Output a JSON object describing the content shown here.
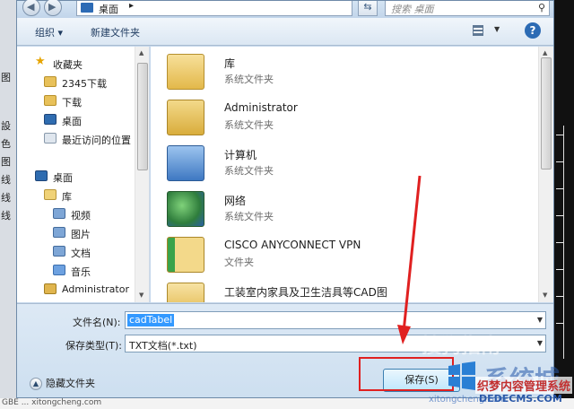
{
  "address_bar": {
    "location": "桌面",
    "search_placeholder": "搜索 桌面"
  },
  "toolbar": {
    "organize": "组织 ▾",
    "new_folder": "新建文件夹"
  },
  "navigation": [
    {
      "label": "收藏夹"
    },
    {
      "label": "2345下载"
    },
    {
      "label": "下载"
    },
    {
      "label": "桌面"
    },
    {
      "label": "最近访问的位置"
    },
    {
      "label": "桌面"
    },
    {
      "label": "库"
    },
    {
      "label": "视频"
    },
    {
      "label": "图片"
    },
    {
      "label": "文档"
    },
    {
      "label": "音乐"
    },
    {
      "label": "Administrator"
    }
  ],
  "files": [
    {
      "name": "库",
      "type": "系统文件夹"
    },
    {
      "name": "Administrator",
      "type": "系统文件夹"
    },
    {
      "name": "计算机",
      "type": "系统文件夹"
    },
    {
      "name": "网络",
      "type": "系统文件夹"
    },
    {
      "name": "CISCO ANYCONNECT VPN",
      "type": "文件夹"
    },
    {
      "name": "工装室内家具及卫生洁具等CAD图",
      "type": "文件夹"
    }
  ],
  "form": {
    "filename_label": "文件名(N):",
    "filename_value": "cadTabel",
    "filetype_label": "保存类型(T):",
    "filetype_value": "TXT文档(*.txt)",
    "hide_folders": "隐藏文件夹",
    "save_button": "保存(S)"
  },
  "background_app": {
    "left_fragments": [
      "图",
      "設",
      "色",
      "图",
      "线",
      "线",
      "线"
    ],
    "bottom_text": "GBE   ...   xitongcheng.com"
  },
  "watermarks": {
    "sogou": "搜狗指南",
    "xitong": "系统城",
    "dede": "织梦内容管理系统",
    "dedecms": "DEDECMS.COM",
    "xitongcheng": "xitongcheng.com"
  },
  "colors": {
    "annotation": "#e02020",
    "selection": "#3399ff"
  }
}
